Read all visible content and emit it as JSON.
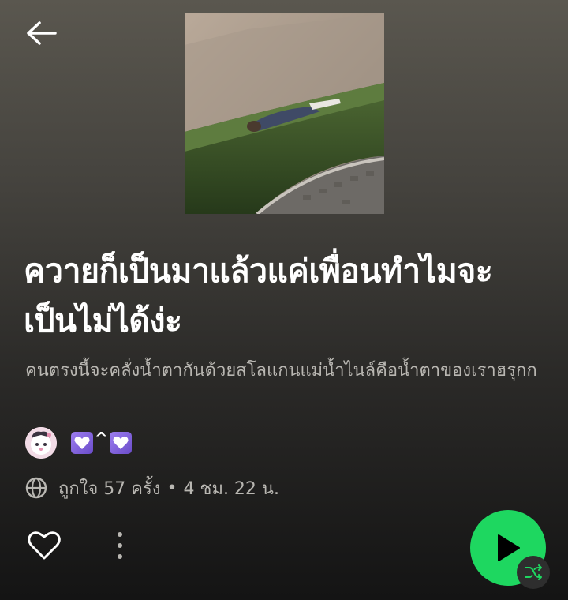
{
  "playlist": {
    "title": "ควายก็เป็นมาแล้วแค่เพื่อนทำไมจะเป็นไม่ได้ง่ะ",
    "description": "คนตรงนี้จะคลั่งน้ำตากันด้วยสโลแกนแม่น้ำไนล์คือน้ำตาของเราฮรุกก",
    "owner_caret": "^",
    "likes_text": "ถูกใจ 57 ครั้ง",
    "separator": "•",
    "duration": "4 ชม. 22 น."
  },
  "icons": {
    "back": "arrow-left-icon",
    "globe": "globe-icon",
    "like": "heart-outline-icon",
    "more": "more-vertical-icon",
    "play": "play-icon",
    "shuffle": "shuffle-icon",
    "owner_emoji": "purple-heart-icon"
  },
  "colors": {
    "accent": "#1ed760",
    "secondary_text": "#b9b7b2",
    "heart_emoji": "#8a6ae0"
  }
}
